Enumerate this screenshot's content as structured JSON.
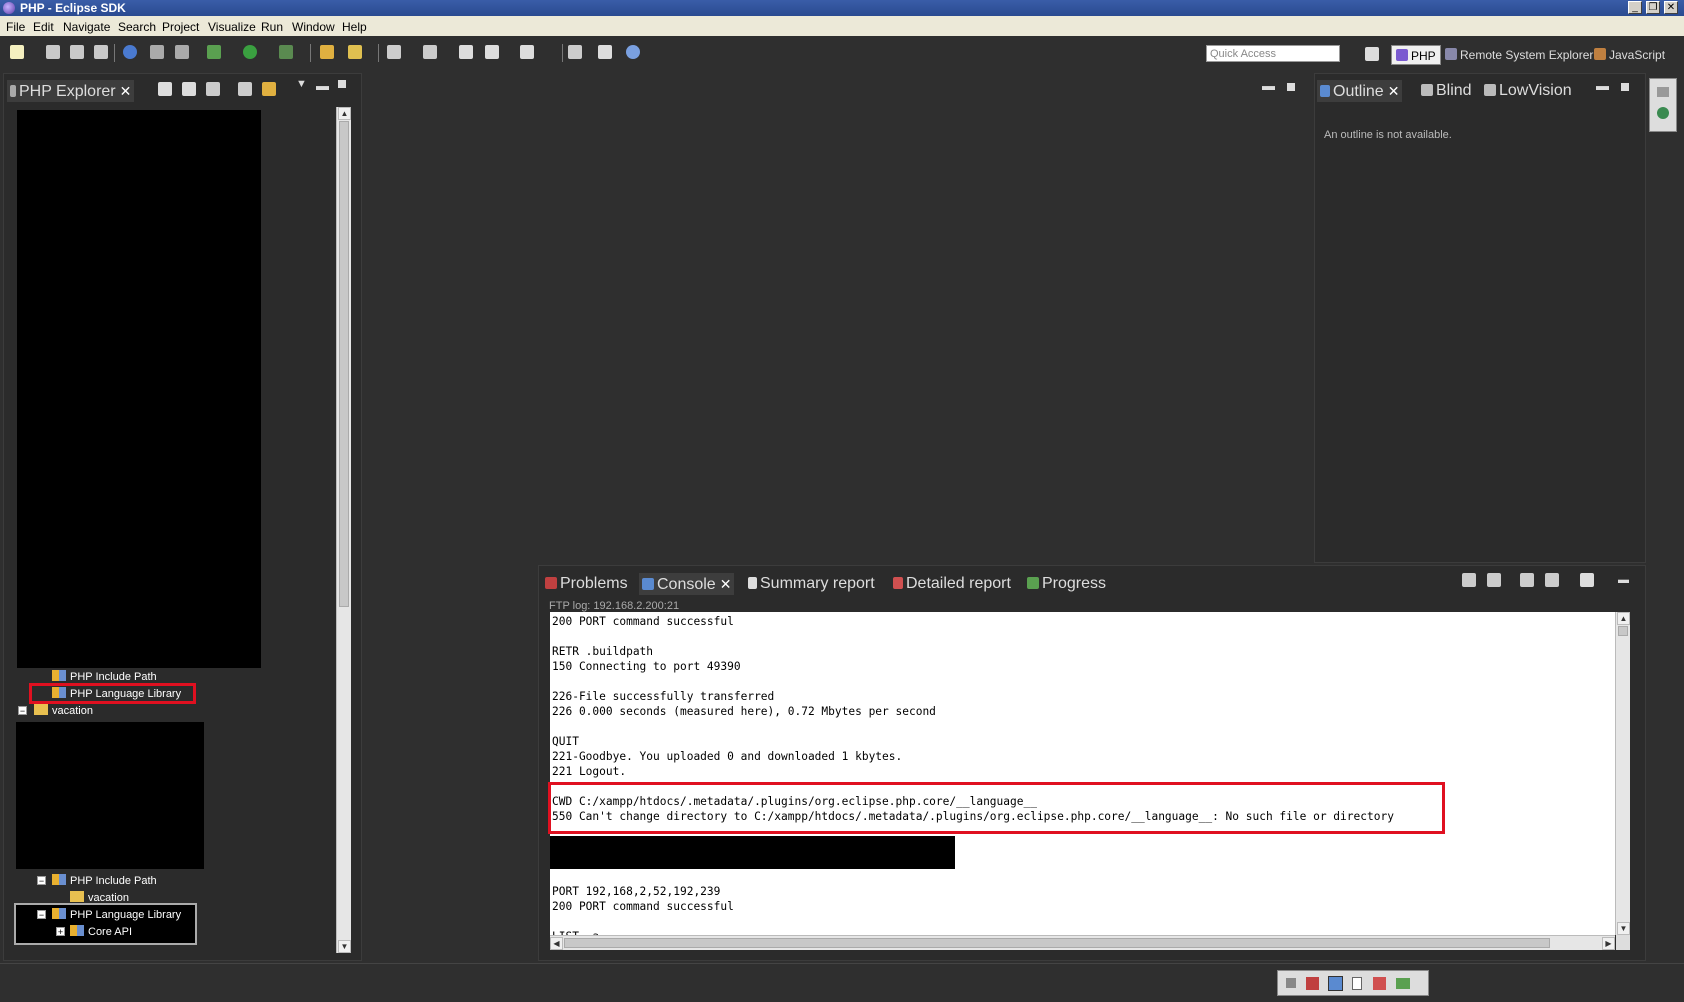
{
  "window": {
    "title": "PHP - Eclipse SDK",
    "controls": [
      "_",
      "❐",
      "✕"
    ]
  },
  "menu": [
    "File",
    "Edit",
    "Navigate",
    "Search",
    "Project",
    "Visualize",
    "Run",
    "Window",
    "Help"
  ],
  "toolbar": {
    "quick_access_placeholder": "Quick Access",
    "perspectives": [
      "PHP",
      "Remote System Explorer",
      "JavaScript"
    ]
  },
  "php_explorer": {
    "tab_label": "PHP Explorer",
    "items": [
      {
        "label": "PHP Include Path",
        "highlighted": false
      },
      {
        "label": "PHP Language Library",
        "highlighted": true
      },
      {
        "label": "vacation",
        "expander": "−"
      },
      {
        "label": "PHP Include Path",
        "expander": "−"
      },
      {
        "label": "vacation"
      },
      {
        "label": "PHP Language Library",
        "expander": "−",
        "selected": true
      },
      {
        "label": "Core API",
        "expander": "+",
        "selected": true
      }
    ]
  },
  "outline": {
    "tabs": [
      "Outline",
      "Blind",
      "LowVision"
    ],
    "message": "An outline is not available."
  },
  "console": {
    "tabs": [
      "Problems",
      "Console",
      "Summary report",
      "Detailed report",
      "Progress"
    ],
    "header": "FTP log: 192.168.2.200:21",
    "lines": [
      "200 PORT command successful",
      "",
      "RETR .buildpath",
      "150 Connecting to port 49390",
      "",
      "226-File successfully transferred",
      "226 0.000 seconds (measured here), 0.72 Mbytes per second",
      "",
      "QUIT",
      "221-Goodbye. You uploaded 0 and downloaded 1 kbytes.",
      "221 Logout.",
      "",
      "CWD C:/xampp/htdocs/.metadata/.plugins/org.eclipse.php.core/__language__",
      "550 Can't change directory to C:/xampp/htdocs/.metadata/.plugins/org.eclipse.php.core/__language__: No such file or directory",
      "",
      "",
      "",
      "",
      "PORT 192,168,2,52,192,239",
      "200 PORT command successful",
      "",
      "LIST -a"
    ]
  },
  "colors": {
    "highlight": "#e01020",
    "background": "#2f2f2f",
    "console_bg": "#ffffff"
  }
}
